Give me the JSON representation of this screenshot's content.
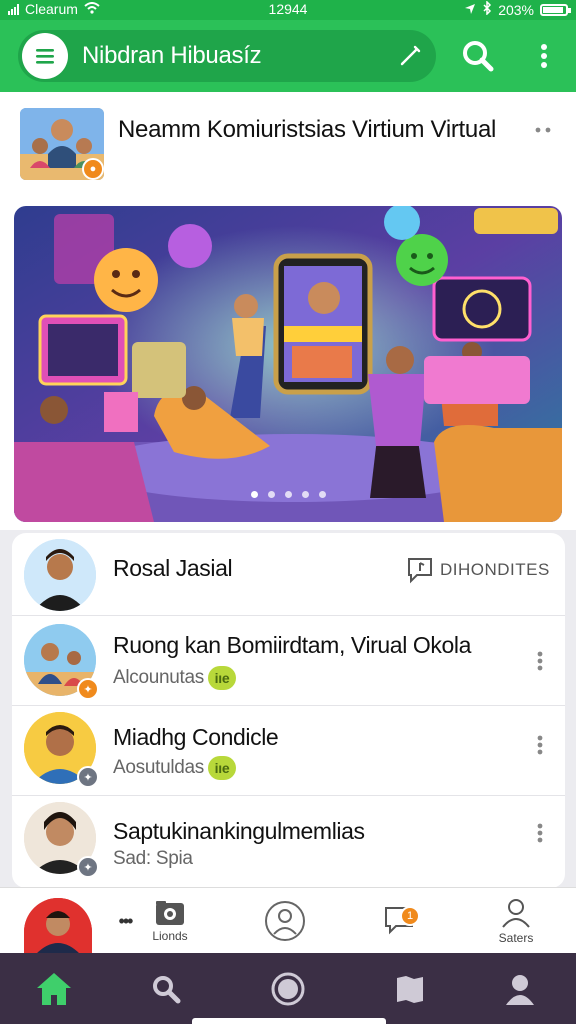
{
  "status_bar": {
    "carrier": "Clearum",
    "time": "12944",
    "battery": "203%",
    "battery_level": 0.9
  },
  "app_bar": {
    "title": "Nibdran Hibuasíz"
  },
  "featured_post": {
    "title": "Neamm Komiuristsias Virtium Virtual",
    "carousel": {
      "pages": 5,
      "active": 0
    }
  },
  "chats": [
    {
      "name": "Rosal Jasial",
      "subtitle": "",
      "action_label": "DIHONDITES",
      "badge": ""
    },
    {
      "name": "Ruong kan Bomiirdtam, Virual Okola",
      "subtitle": "Alcounutas",
      "sub_badge": "iıe",
      "badge": "✦"
    },
    {
      "name": "Miadhg Condicle",
      "subtitle": "Aosutuldas",
      "sub_badge": "iıe",
      "badge": "✦"
    },
    {
      "name": "Saptukinankingulmemlias",
      "subtitle": "Sad: Spia",
      "badge": "✦"
    }
  ],
  "dock": {
    "more_label": "•••",
    "photos_label": "Lionds",
    "messages_badge": "1",
    "profile_label": "Saters"
  },
  "colors": {
    "primary": "#2bc158",
    "primary_dark": "#1fa54a",
    "nav_bg": "#3b2f45",
    "accent": "#3fcf6b",
    "badge_orange": "#f08a1c"
  }
}
